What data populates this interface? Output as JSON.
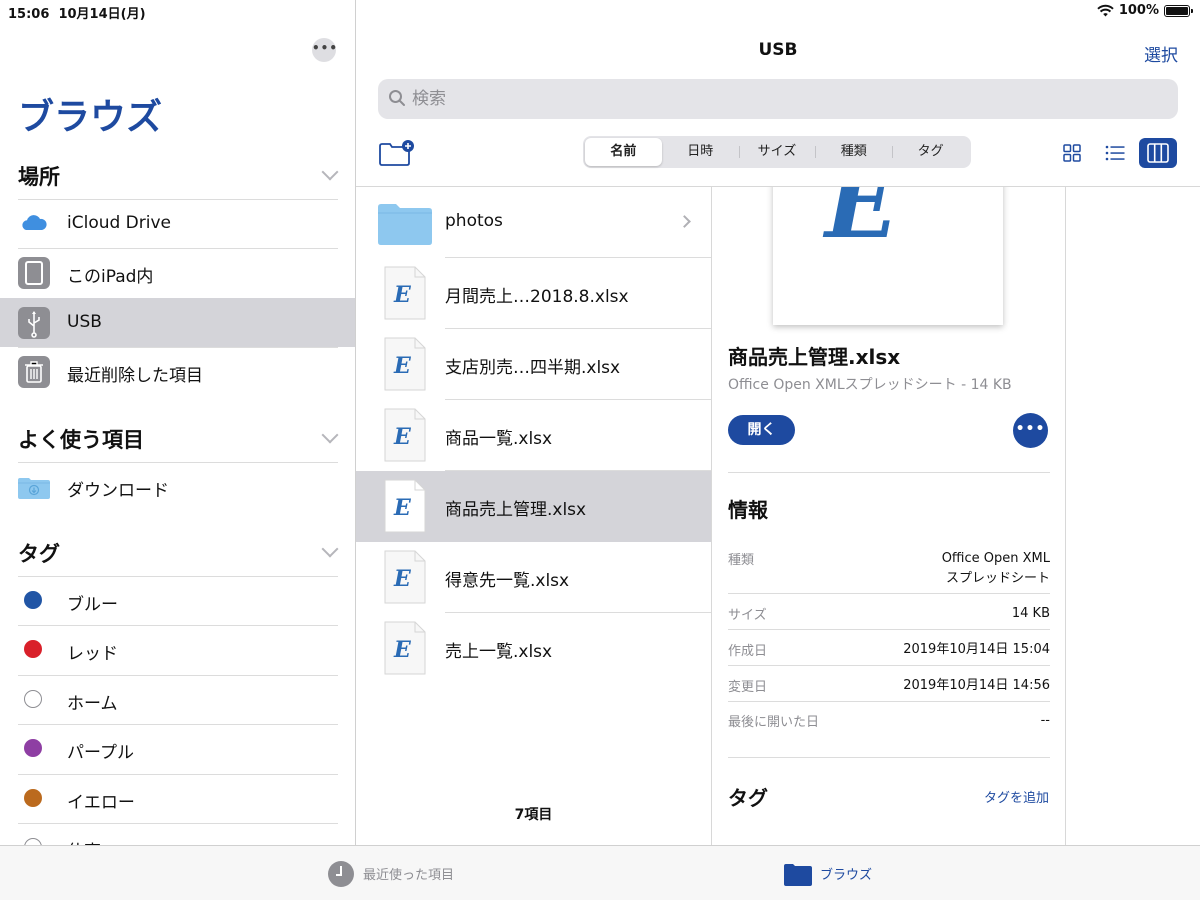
{
  "status": {
    "time": "15:06",
    "date": "10月14日(月)",
    "battery": "100%"
  },
  "sidebar": {
    "title": "ブラウズ",
    "locations": {
      "heading": "場所",
      "items": [
        {
          "label": "iCloud Drive",
          "icon": "icloud-icon"
        },
        {
          "label": "このiPad内",
          "icon": "ipad-icon"
        },
        {
          "label": "USB",
          "icon": "usb-icon",
          "selected": true
        },
        {
          "label": "最近削除した項目",
          "icon": "trash-icon"
        }
      ]
    },
    "favorites": {
      "heading": "よく使う項目",
      "items": [
        {
          "label": "ダウンロード",
          "icon": "download-folder-icon"
        }
      ]
    },
    "tags": {
      "heading": "タグ",
      "items": [
        {
          "label": "ブルー",
          "color": "#2155a5"
        },
        {
          "label": "レッド",
          "color": "#d9202a"
        },
        {
          "label": "ホーム",
          "color": "#ffffff"
        },
        {
          "label": "パープル",
          "color": "#8e3ea3"
        },
        {
          "label": "イエロー",
          "color": "#bb6a1e"
        },
        {
          "label": "仕事",
          "color": "#ffffff"
        }
      ]
    }
  },
  "main": {
    "title": "USB",
    "select_label": "選択",
    "search_placeholder": "検索",
    "sort_options": [
      "名前",
      "日時",
      "サイズ",
      "種類",
      "タグ"
    ],
    "files": [
      {
        "name": "photos",
        "type": "folder"
      },
      {
        "name": "月間売上…2018.8.xlsx",
        "type": "xlsx"
      },
      {
        "name": "支店別売…四半期.xlsx",
        "type": "xlsx"
      },
      {
        "name": "商品一覧.xlsx",
        "type": "xlsx"
      },
      {
        "name": "商品売上管理.xlsx",
        "type": "xlsx",
        "selected": true
      },
      {
        "name": "得意先一覧.xlsx",
        "type": "xlsx"
      },
      {
        "name": "売上一覧.xlsx",
        "type": "xlsx"
      }
    ],
    "item_count": "7項目"
  },
  "detail": {
    "preview_letter": "E",
    "name": "商品売上管理.xlsx",
    "type_size": "Office Open XMLスプレッドシート - 14 KB",
    "open_label": "開く",
    "info_heading": "情報",
    "info": [
      {
        "key": "種類",
        "value": "Office Open XML\nスプレッドシート"
      },
      {
        "key": "サイズ",
        "value": "14 KB"
      },
      {
        "key": "作成日",
        "value": "2019年10月14日 15:04"
      },
      {
        "key": "変更日",
        "value": "2019年10月14日 14:56"
      },
      {
        "key": "最後に開いた日",
        "value": "--"
      }
    ],
    "tags_heading": "タグ",
    "add_tag_label": "タグを追加"
  },
  "tabbar": {
    "recents": "最近使った項目",
    "browse": "ブラウズ"
  },
  "colors": {
    "accent": "#1e4aa0",
    "selected_bg": "#d4d4d9"
  }
}
